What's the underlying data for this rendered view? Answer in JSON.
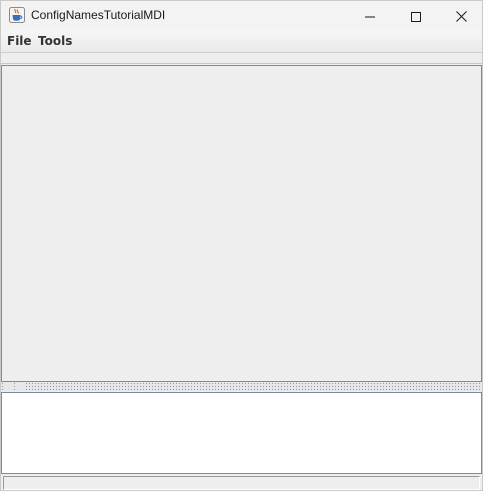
{
  "window": {
    "title": "ConfigNamesTutorialMDI",
    "icon": "java-coffee-cup-icon",
    "controls": {
      "minimize_icon": "minimize-icon",
      "maximize_icon": "maximize-icon",
      "close_icon": "close-icon"
    }
  },
  "menubar": {
    "items": [
      {
        "label": "File"
      },
      {
        "label": "Tools"
      }
    ]
  },
  "colors": {
    "background": "#eeeeee",
    "pane_border": "#7a8aa6",
    "text_area": "#ffffff",
    "close_hover": "#e81123"
  },
  "status_bar": {
    "text": ""
  }
}
